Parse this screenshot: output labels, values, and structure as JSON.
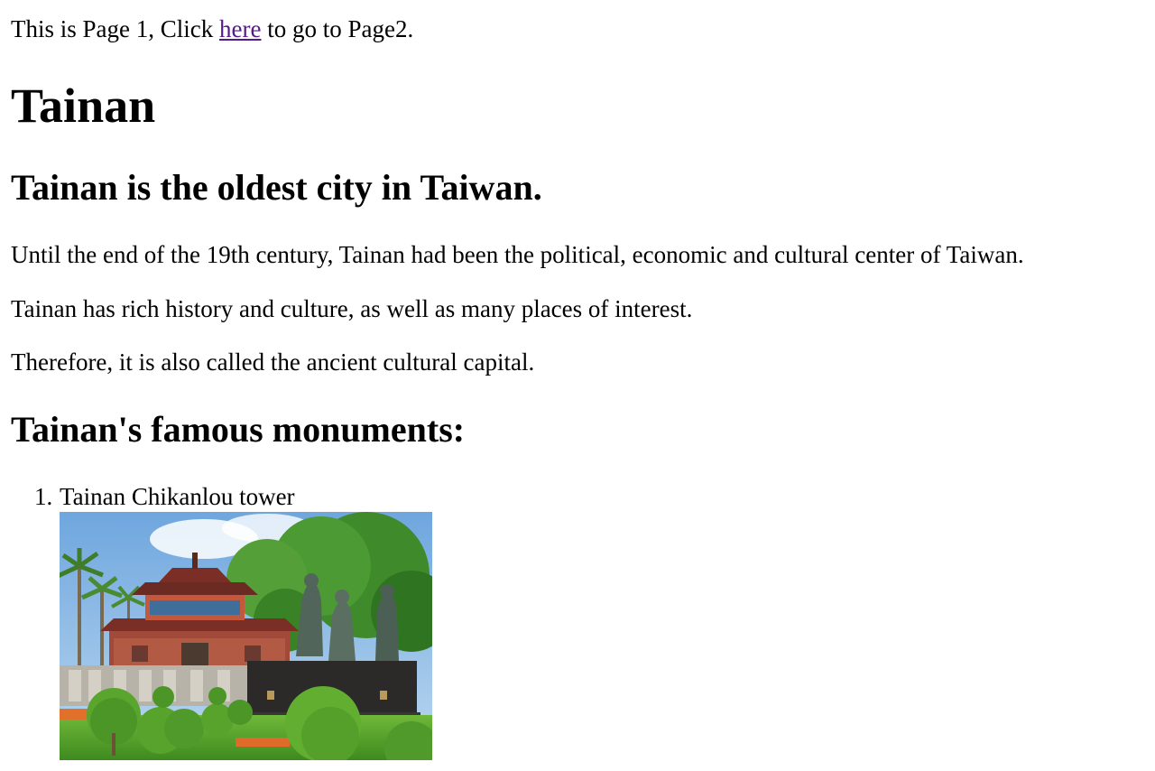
{
  "intro": {
    "prefix": "This is Page 1, Click ",
    "link_text": "here",
    "suffix": " to go to Page2."
  },
  "title": "Tainan",
  "subtitle": "Tainan is the oldest city in Taiwan.",
  "paragraphs": [
    "Until the end of the 19th century, Tainan had been the political, economic and cultural center of Taiwan.",
    "Tainan has rich history and culture, as well as many places of interest.",
    "Therefore, it is also called the ancient cultural capital."
  ],
  "monuments_heading": "Tainan's famous monuments:",
  "monuments": [
    {
      "number": "1.",
      "name": "Tainan Chikanlou tower",
      "image": "tower-photo"
    }
  ],
  "colors": {
    "link_visited": "#551a8b",
    "text": "#000000",
    "background": "#ffffff"
  }
}
